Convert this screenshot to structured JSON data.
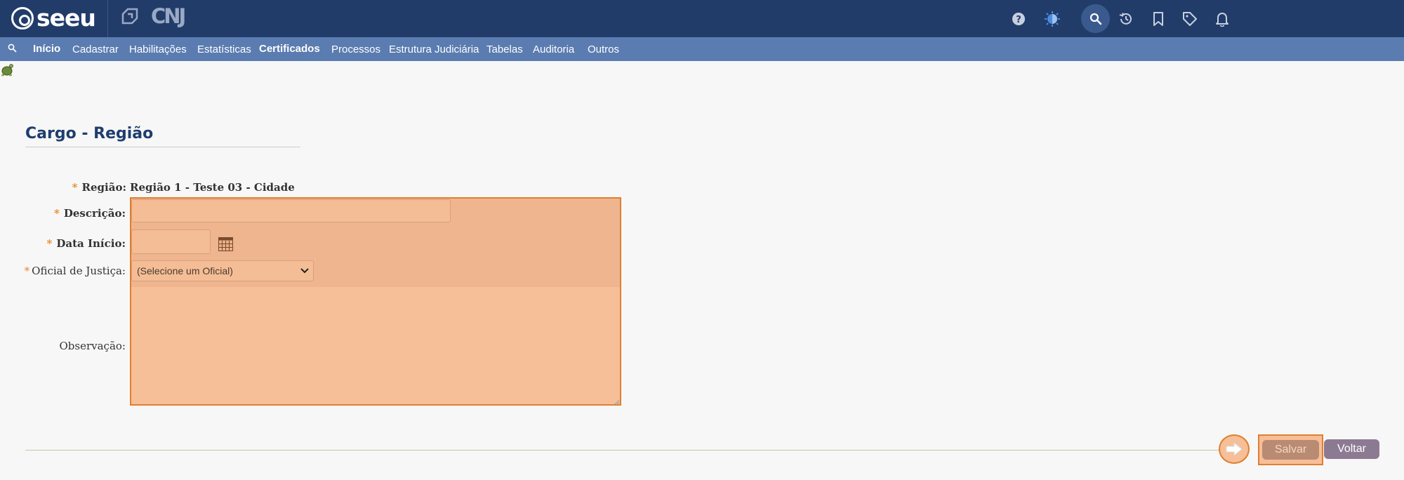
{
  "header": {
    "logo_text": "seeu",
    "partner_logo_text": "CNJ",
    "icons": [
      "help-icon",
      "theme-icon",
      "search-icon",
      "history-icon",
      "bookmark-icon",
      "tag-icon",
      "bell-icon"
    ]
  },
  "nav": {
    "items": [
      {
        "label": "Início"
      },
      {
        "label": "Cadastrar"
      },
      {
        "label": "Habilitações"
      },
      {
        "label": "Estatísticas"
      },
      {
        "label": "Certificados"
      },
      {
        "label": "Processos"
      },
      {
        "label": "Estrutura Judiciária"
      },
      {
        "label": "Tabelas"
      },
      {
        "label": "Auditoria"
      },
      {
        "label": "Outros"
      }
    ]
  },
  "page": {
    "title": "Cargo - Região"
  },
  "form": {
    "required_mark": "*",
    "regiao_label": "Região:",
    "regiao_value": "Região 1 - Teste 03 - Cidade",
    "descricao_label": "Descrição:",
    "descricao_value": "",
    "data_inicio_label": "Data Início:",
    "data_inicio_value": "",
    "oficial_label": "Oficial de Justiça:",
    "oficial_selected": "(Selecione um Oficial)",
    "observacao_label": "Observação:",
    "observacao_value": ""
  },
  "actions": {
    "salvar_label": "Salvar",
    "voltar_label": "Voltar"
  },
  "colors": {
    "header_bg": "#223c6a",
    "nav_bg": "#5a7cb0",
    "title": "#1f3d6e",
    "required": "#e68a2e",
    "highlight_border": "#e07f2f",
    "highlight_fill": "#f7bf97"
  }
}
